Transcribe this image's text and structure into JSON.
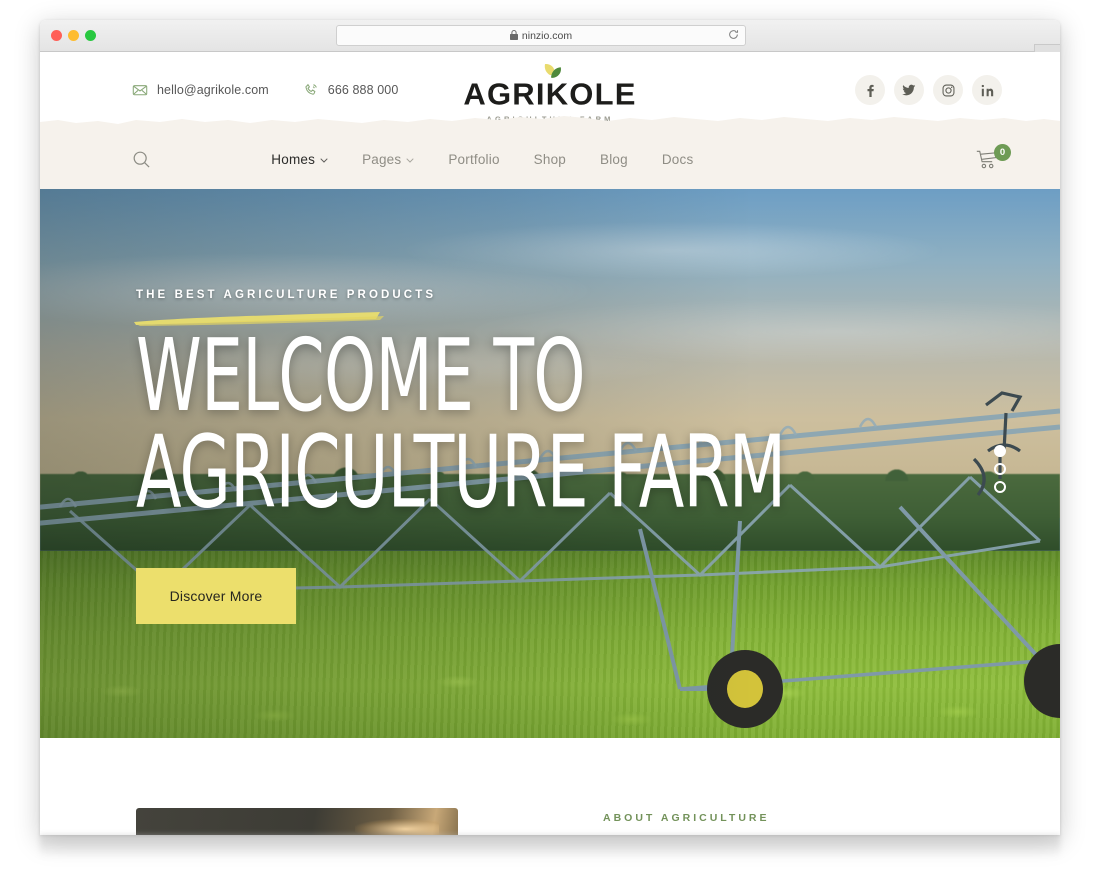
{
  "browser": {
    "url": "ninzio.com",
    "lock_icon": "lock-icon",
    "reload_icon": "reload-icon",
    "newtab_label": "+",
    "traffic_lights": [
      "close",
      "minimize",
      "maximize"
    ]
  },
  "topbar": {
    "email": "hello@agrikole.com",
    "phone": "666 888 000",
    "email_icon": "envelope-icon",
    "phone_icon": "phone-icon",
    "logo": {
      "word": "AGRIKOLE",
      "tagline": "AGRICULTURE FARM",
      "leaf_icon": "leaf-icon"
    },
    "social": [
      {
        "name": "facebook",
        "label": "f"
      },
      {
        "name": "twitter",
        "label": "t"
      },
      {
        "name": "instagram",
        "label": "ig"
      },
      {
        "name": "linkedin",
        "label": "in"
      }
    ]
  },
  "nav": {
    "search_icon": "search-icon",
    "items": [
      {
        "label": "Homes",
        "has_dropdown": true,
        "active": true
      },
      {
        "label": "Pages",
        "has_dropdown": true,
        "active": false
      },
      {
        "label": "Portfolio",
        "has_dropdown": false,
        "active": false
      },
      {
        "label": "Shop",
        "has_dropdown": false,
        "active": false
      },
      {
        "label": "Blog",
        "has_dropdown": false,
        "active": false
      },
      {
        "label": "Docs",
        "has_dropdown": false,
        "active": false
      }
    ],
    "caret": "⌄",
    "cart_icon": "shopping-cart-icon",
    "cart_count": "0"
  },
  "hero": {
    "eyebrow": "THE BEST AGRICULTURE PRODUCTS",
    "title_line1": "Welcome to",
    "title_line2": "Agriculture Farm",
    "cta_label": "Discover More",
    "slides_total": 3,
    "active_slide": 1,
    "image_alt": "center-pivot irrigation system over a green crop field at dusk"
  },
  "about": {
    "eyebrow": "ABOUT AGRICULTURE",
    "image_alt": "sunset clouds photo"
  },
  "colors": {
    "accent_yellow": "#ecdf6c",
    "brand_green": "#6e9b55",
    "eyebrow_green": "#73925a",
    "nav_background": "#f6f2ec",
    "social_background": "#f3f1ec",
    "logo_dark": "#1d1d1b"
  }
}
